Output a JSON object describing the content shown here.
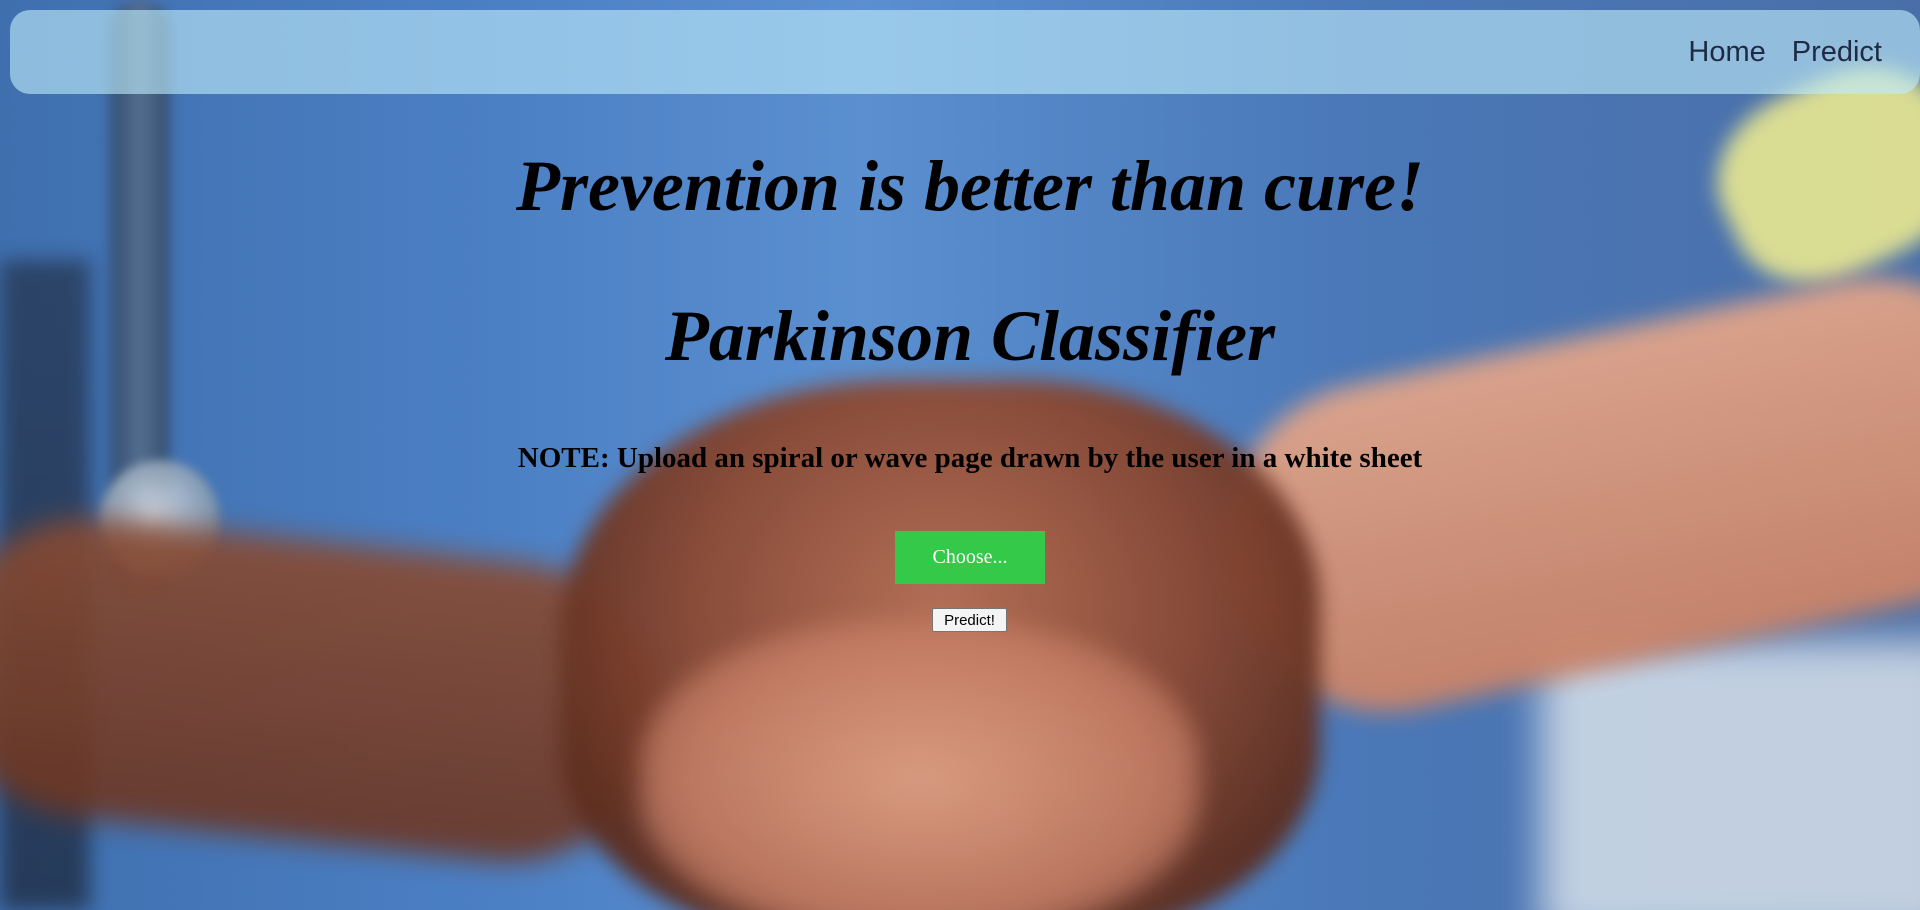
{
  "navbar": {
    "links": [
      {
        "label": "Home"
      },
      {
        "label": "Predict"
      }
    ],
    "background_color": "#bcebfa"
  },
  "hero": {
    "motto": "Prevention is better than cure!",
    "title": "Parkinson Classifier",
    "note": "NOTE: Upload an spiral or wave page drawn by the user in a white sheet"
  },
  "upload": {
    "choose_label": "Choose...",
    "choose_color": "#35c94a",
    "predict_label": "Predict!"
  },
  "background": {
    "description_icon": "medical-hands-photo"
  }
}
